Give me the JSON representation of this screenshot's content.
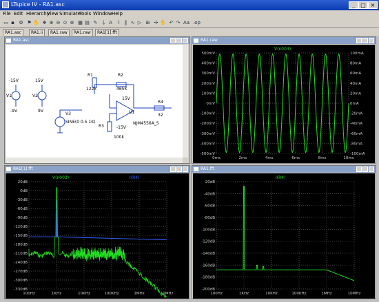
{
  "window": {
    "title": "LTspice IV - RA1.asc"
  },
  "menu": [
    "File",
    "Edit",
    "Hierarchy",
    "View",
    "Simulate",
    "Tools",
    "Window",
    "Help"
  ],
  "tabs": [
    "RA1.asc",
    "RA1.ii",
    "RA1.raw",
    "RA1.raw",
    "RA1[1].fft"
  ],
  "schematic": {
    "title": "RA1.asc",
    "v1_label": "V1",
    "v1_top": "-15V",
    "v1_bot": "-9V",
    "v2_label": "V2",
    "v2_top": "15V",
    "v2_bot": "9V",
    "r1_label": "R1",
    "r1_val": "122k",
    "r2_label": "R2",
    "r2_val": "465K",
    "r3_label": "R3",
    "r3_val": "100k",
    "r4_label": "R4",
    "r4_val": "32",
    "u1_label": "U1",
    "u1_part": "NJM4556A_S",
    "v3_label": "V3",
    "v3_val": "SINE(0 0.5 1K)",
    "opamp_pos": "15V",
    "opamp_neg": "-15V"
  },
  "plot_time": {
    "title": "RA1.raw",
    "trace": "V(n003)",
    "left_ticks": [
      "500mV",
      "400mV",
      "300mV",
      "200mV",
      "100mV",
      "0mV",
      "-100mV",
      "-200mV",
      "-300mV",
      "-400mV",
      "-500mV"
    ],
    "right_ticks": [
      "100mA",
      "80mA",
      "60mA",
      "40mA",
      "20mA",
      "0mA",
      "-20mA",
      "-40mA",
      "-60mA",
      "-80mA",
      "-100mA"
    ],
    "x_ticks": [
      "0ms",
      "2ms",
      "4ms",
      "6ms",
      "8ms",
      "10ms"
    ]
  },
  "plot_fft1": {
    "title": "RA1[1].fft",
    "trace": "V(n003)",
    "trace2": "I(R4)",
    "y_ticks": [
      "20dB",
      "0dB",
      "-30dB",
      "-60dB",
      "-90dB",
      "-120dB",
      "-150dB",
      "-180dB",
      "-210dB",
      "-240dB",
      "-270dB",
      "-300dB",
      "-330dB"
    ],
    "x_ticks": [
      "100Hz",
      "1KHz",
      "10KHz",
      "100KHz",
      "1MHz",
      "10MHz"
    ]
  },
  "plot_fft2": {
    "title": "RA1.fft",
    "trace": "I(R4)",
    "y_ticks": [
      "-20dB",
      "-40dB",
      "-60dB",
      "-80dB",
      "-100dB",
      "-120dB",
      "-140dB",
      "-160dB",
      "-180dB",
      "-200dB"
    ],
    "x_ticks": [
      "100Hz",
      "1KHz",
      "10KHz",
      "100KHz",
      "1MHz",
      "10MHz"
    ]
  },
  "colors": {
    "trace": "#22dd22",
    "trace_blue": "#3060ff",
    "bg": "#000000"
  }
}
